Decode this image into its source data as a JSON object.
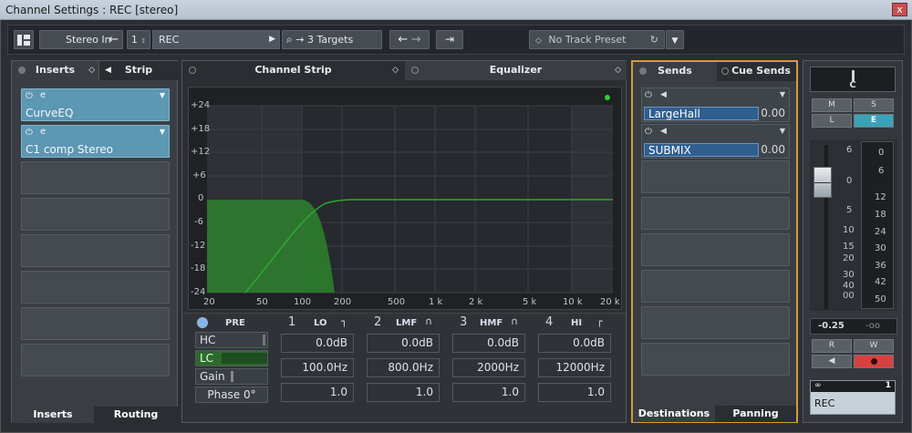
{
  "window": {
    "title": "Channel Settings : REC [stereo]",
    "close_label": "x"
  },
  "toolbar": {
    "input": "Stereo In",
    "channel_number": "1",
    "channel_name": "REC",
    "targets": "3 Targets",
    "preset": "No Track Preset"
  },
  "inserts": {
    "tab_inserts": "Inserts",
    "tab_strip": "Strip",
    "slots": [
      {
        "name": "CurveEQ"
      },
      {
        "name": "C1 comp Stereo"
      }
    ],
    "bottom_tabs": [
      "Inserts",
      "Routing"
    ]
  },
  "center": {
    "tab_channel_strip": "Channel Strip",
    "tab_equalizer": "Equalizer"
  },
  "eq": {
    "y_ticks": [
      "+24",
      "+18",
      "+12",
      "+6",
      "0",
      "-6",
      "-12",
      "-18",
      "-24"
    ],
    "x_ticks": [
      "20",
      "50",
      "100",
      "200",
      "500",
      "1 k",
      "2 k",
      "5 k",
      "10 k",
      "20 k"
    ],
    "pre_label": "PRE",
    "hc_label": "HC",
    "lc_label": "LC",
    "gain_label": "Gain",
    "phase_label": "Phase 0°",
    "bands": [
      {
        "num": "1",
        "name": "LO",
        "gain": "0.0dB",
        "freq": "100.0Hz",
        "q": "1.0"
      },
      {
        "num": "2",
        "name": "LMF",
        "gain": "0.0dB",
        "freq": "800.0Hz",
        "q": "1.0"
      },
      {
        "num": "3",
        "name": "HMF",
        "gain": "0.0dB",
        "freq": "2000Hz",
        "q": "1.0"
      },
      {
        "num": "4",
        "name": "HI",
        "gain": "0.0dB",
        "freq": "12000Hz",
        "q": "1.0"
      }
    ]
  },
  "sends": {
    "tab_sends": "Sends",
    "tab_cue": "Cue Sends",
    "items": [
      {
        "name": "LargeHall",
        "value": "0.00"
      },
      {
        "name": "SUBMIX",
        "value": "0.00"
      }
    ],
    "bottom_tabs": [
      "Destinations",
      "Panning"
    ]
  },
  "fader": {
    "pan": "C",
    "m": "M",
    "s": "S",
    "l": "L",
    "e": "E",
    "scale_left": [
      "6",
      "0",
      "5",
      "10",
      "15",
      "20",
      "30",
      "40",
      "00"
    ],
    "scale_right": [
      "0",
      "6",
      "12",
      "18",
      "24",
      "30",
      "36",
      "42",
      "50"
    ],
    "volume": "-0.25",
    "peak": "-oo",
    "r": "R",
    "w": "W",
    "track_number": "1",
    "track_name": "REC"
  }
}
